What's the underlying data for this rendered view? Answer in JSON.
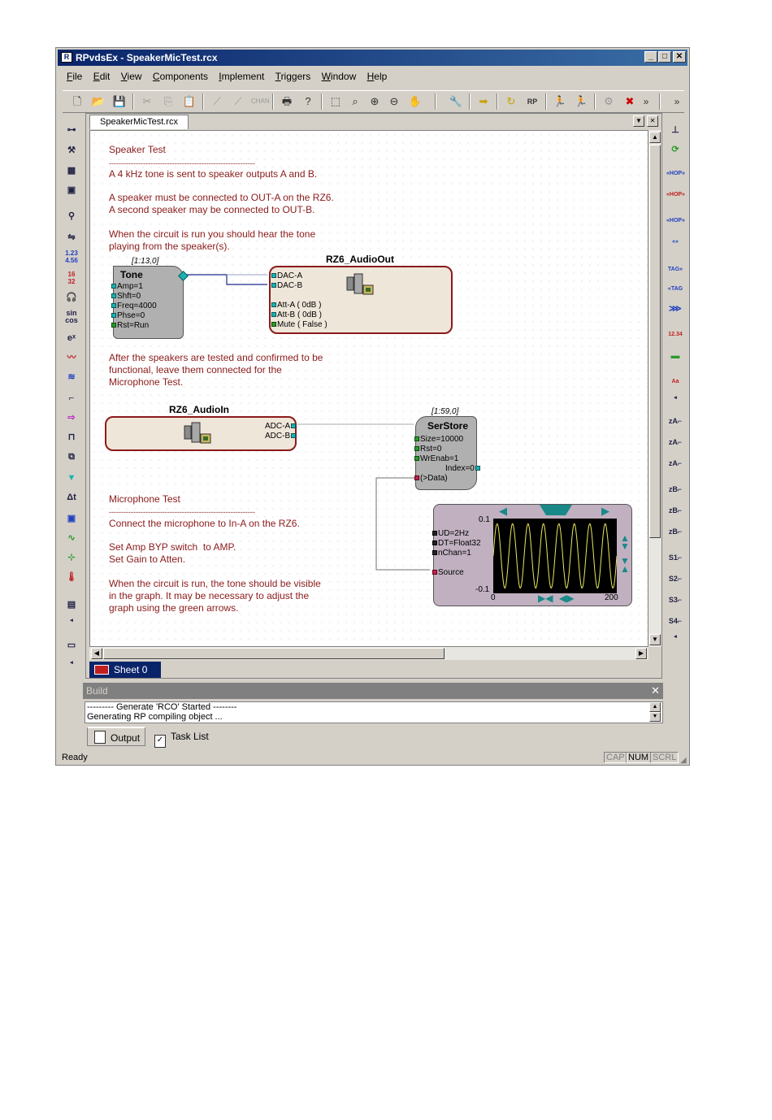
{
  "window": {
    "title": "RPvdsEx - SpeakerMicTest.rcx",
    "title_icon": "app-icon"
  },
  "menu": [
    {
      "key": "F",
      "rest": "ile"
    },
    {
      "key": "E",
      "rest": "dit"
    },
    {
      "key": "V",
      "rest": "iew"
    },
    {
      "key": "C",
      "rest": "omponents"
    },
    {
      "key": "I",
      "rest": "mplement"
    },
    {
      "key": "T",
      "rest": "riggers"
    },
    {
      "key": "W",
      "rest": "indow"
    },
    {
      "key": "H",
      "rest": "elp"
    }
  ],
  "toolbar_overflow": "»",
  "document": {
    "tab": "SpeakerMicTest.rcx"
  },
  "notes": {
    "speaker_title": "Speaker Test",
    "dash1": "------------------------------------------------------------",
    "speaker_l1": "A 4 kHz tone is sent to speaker outputs A and B.",
    "speaker_l2": "A speaker must be connected to OUT-A on the RZ6.",
    "speaker_l3": "A second speaker may be connected to OUT-B.",
    "speaker_l4": "When the circuit is run you should hear the tone",
    "speaker_l5": "playing from the speaker(s).",
    "after_l1": "After the speakers are tested and confirmed to be",
    "after_l2": "functional, leave them connected for the",
    "after_l3": "Microphone Test.",
    "mic_title": "Microphone Test",
    "dash2": "------------------------------------------------------------",
    "mic_l1": "Connect the microphone to In-A on the RZ6.",
    "mic_l2": "Set Amp BYP switch  to AMP.",
    "mic_l3": "Set Gain to Atten.",
    "mic_l4": "When the circuit is run, the tone should be visible",
    "mic_l5": "in the graph. It may be necessary to adjust the",
    "mic_l6": "graph using the green arrows."
  },
  "tone": {
    "coord": "[1:13,0]",
    "name": "Tone",
    "params": [
      "Amp=1",
      "Shft=0",
      "Freq=4000",
      "Phse=0",
      "Rst=Run"
    ]
  },
  "audioout": {
    "name": "RZ6_AudioOut",
    "ports": [
      "DAC-A",
      "DAC-B"
    ],
    "params": [
      "Att-A   ( 0dB )",
      "Att-B   ( 0dB )",
      "Mute   ( False )"
    ]
  },
  "audioin": {
    "name": "RZ6_AudioIn",
    "ports": [
      "ADC-A",
      "ADC-B"
    ]
  },
  "serstore": {
    "coord": "[1:59,0]",
    "name": "SerStore",
    "params": [
      "Size=10000",
      "Rst=0",
      "WrEnab=1"
    ],
    "index": "Index=0",
    "data": "(>Data)"
  },
  "scope": {
    "params": [
      "UD=2Hz",
      "DT=Float32",
      "nChan=1"
    ],
    "source": "Source",
    "ymax": "0.1",
    "ymin": "-0.1",
    "xmin": "0",
    "xmax": "200"
  },
  "scope_data": {
    "cycles": 8,
    "amplitude": 0.09
  },
  "sheet": {
    "label": "Sheet 0"
  },
  "build": {
    "title": "Build",
    "line1": "---------     Generate 'RCO' Started     --------",
    "line2": "Generating RP compiling object ...",
    "tab_output": "Output",
    "tab_tasks": "Task List"
  },
  "status": {
    "text": "Ready",
    "cap": "CAP",
    "num": "NUM",
    "scrl": "SCRL"
  },
  "colors": {
    "note_text": "#8b1a1a",
    "block_gray": "#b0b0b0",
    "hw_fill": "#efe6da",
    "hw_border": "#8b1a1a",
    "scope_fill": "#c0b0c0",
    "wave": "#e8e85a",
    "port": "#19b3b3"
  }
}
